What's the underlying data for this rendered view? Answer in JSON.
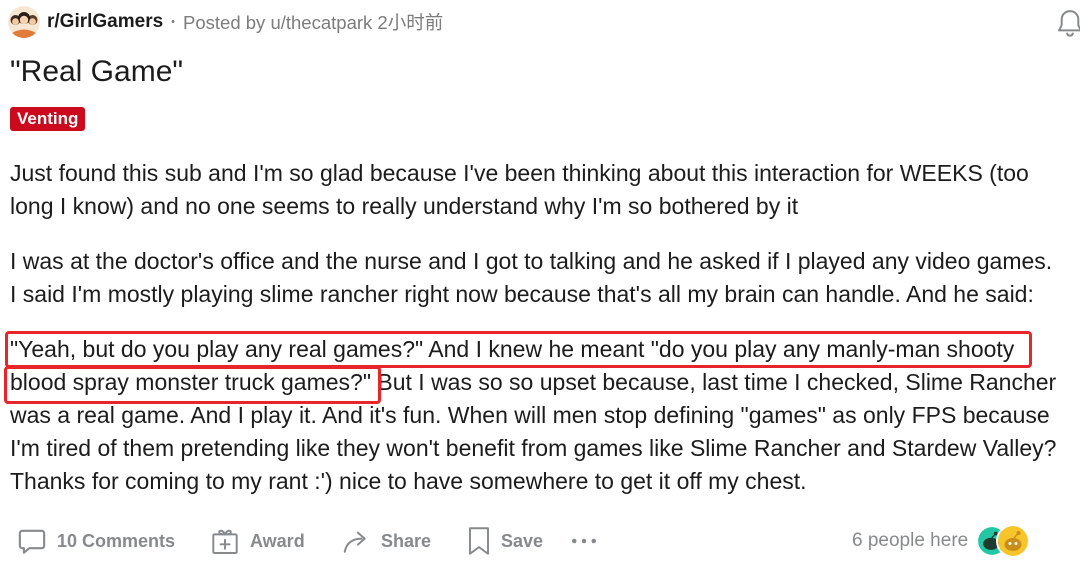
{
  "post": {
    "subreddit": "r/GirlGamers",
    "separator": "•",
    "posted_by_label": "Posted by",
    "author": "u/thecatpark",
    "time": "2小时前",
    "title": "\"Real Game\"",
    "flair": "Venting",
    "body": [
      {
        "lines": [
          "Just found this sub and I'm so glad because I've been thinking about this interaction for WEEKS (too",
          "long I know) and no one seems to really understand why I'm so bothered by it"
        ]
      },
      {
        "lines": [
          "I was at the doctor's office and the nurse and I got to talking and he asked if I played any video games.",
          "I said I'm mostly playing slime rancher right now because that's all my brain can handle. And he said:"
        ]
      },
      {
        "lines": [
          "\"Yeah, but do you play any real games?\" And I knew he meant \"do you play any manly-man shooty",
          "blood spray monster truck games?\" But I was so so upset because, last time I checked, Slime Rancher",
          "was a real game. And I play it. And it's fun. When will men stop defining \"games\" as only FPS because",
          "I'm tired of them pretending like they won't benefit from games like Slime Rancher and Stardew Valley?",
          "Thanks for coming to my rant :') nice to have somewhere to get it off my chest."
        ]
      }
    ]
  },
  "actions": {
    "comments": "10 Comments",
    "award": "Award",
    "share": "Share",
    "save": "Save"
  },
  "presence": {
    "label": "6 people here"
  },
  "icons": {
    "subreddit": "subreddit-avatar",
    "notifications": "bell-icon",
    "comments": "comment-icon",
    "award": "gift-icon",
    "share": "share-icon",
    "save": "bookmark-icon",
    "more": "more-options-icon",
    "online_users": "user-avatar"
  },
  "colors": {
    "text": "#1c1c1c",
    "meta": "#7c7c7c",
    "action": "#878a8c",
    "flair_bg": "#cc0a1e",
    "flair_text": "#ffffff",
    "annotation": "#e8252b"
  }
}
